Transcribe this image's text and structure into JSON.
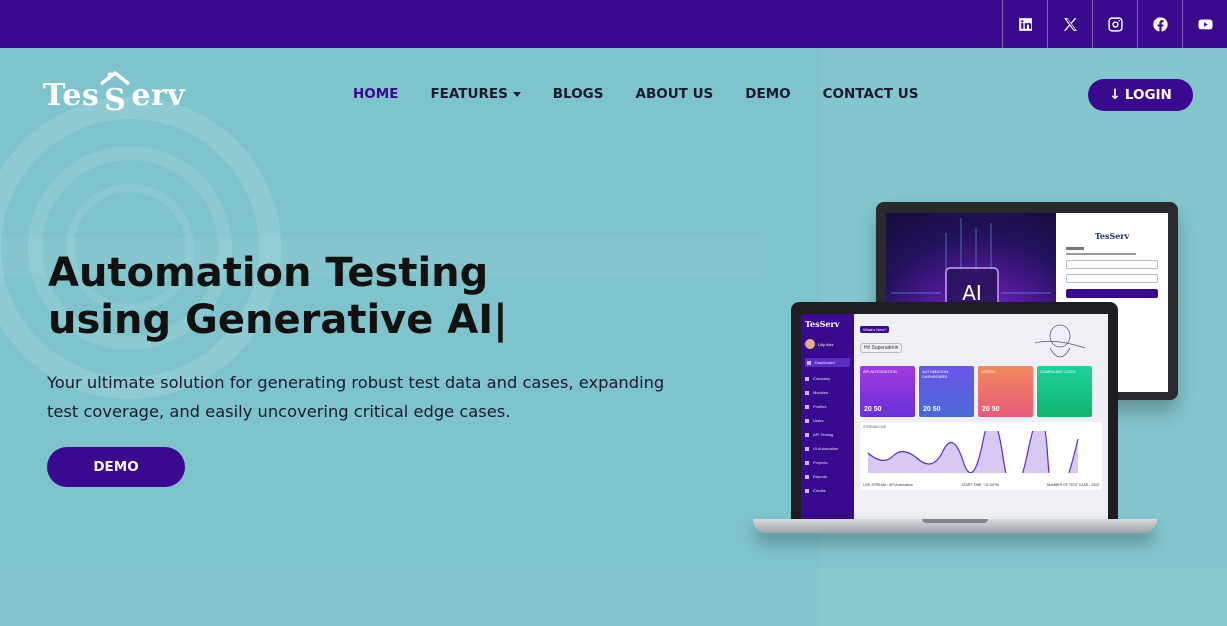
{
  "social": [
    {
      "name": "linkedin-icon"
    },
    {
      "name": "x-icon"
    },
    {
      "name": "instagram-icon"
    },
    {
      "name": "facebook-icon"
    },
    {
      "name": "youtube-icon"
    }
  ],
  "brand": {
    "logo_left": "Tes",
    "logo_right": "erv"
  },
  "nav": {
    "home": "HOME",
    "features": "FEATURES",
    "blogs": "BLOGS",
    "about": "ABOUT US",
    "demo": "DEMO",
    "contact": "CONTACT US"
  },
  "login_label": "LOGIN",
  "hero": {
    "title_line1": "Automation Testing",
    "title_line2": "using Generative AI|",
    "subtitle": "Your ultimate solution for generating robust test data and cases, expanding test coverage, and easily uncovering critical edge cases.",
    "demo_label": "DEMO"
  },
  "mockup": {
    "monitor_ai": "AI",
    "monitor_logo": "TesServ",
    "laptop_logo": "TesServ",
    "whats_new": "What's New?",
    "greeting": "Hi! Superadmin",
    "user_name": "Lilly Alex",
    "side_items": [
      "Dashboard",
      "Company",
      "Modules",
      "Profiles",
      "Users",
      "API Testing",
      "UI Automation",
      "Projects",
      "Reports",
      "Credits"
    ],
    "cards": [
      {
        "title": "API AUTOMATION",
        "a": "20",
        "b": "50"
      },
      {
        "title": "AUTOMATION DASHBOARD",
        "a": "20",
        "b": "50"
      },
      {
        "title": "USERS",
        "a": "20",
        "b": "50"
      },
      {
        "title": "COMPLIANT LOGS",
        "a": "",
        "b": ""
      }
    ],
    "stream_label": "STREAM LIVE",
    "footer_left": "LIVE STREAM : API Automation",
    "footer_mid": "START TIME : 01:20PM",
    "footer_right": "NUMBER OF TEST CASE : 2303"
  },
  "colors": {
    "primary": "#3a0a8e",
    "background": "#7fc4cd"
  }
}
